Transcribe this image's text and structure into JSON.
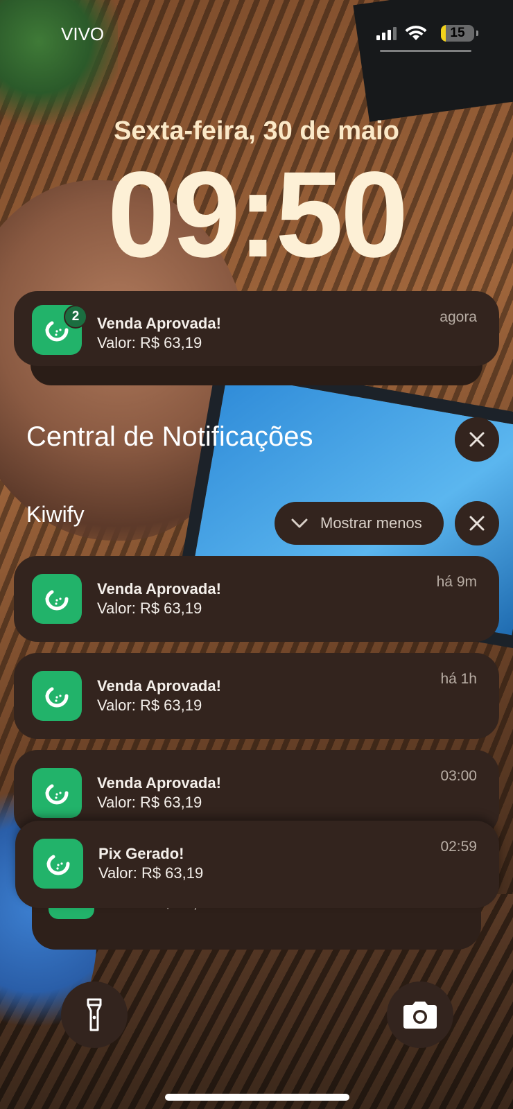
{
  "status_bar": {
    "carrier": "VIVO",
    "battery_level": "15",
    "battery_color": "#f2d21b",
    "icons": [
      "cellular-signal-icon",
      "wifi-icon",
      "battery-icon"
    ]
  },
  "lock_screen": {
    "date": "Sexta-feira, 30 de maio",
    "time": "09:50"
  },
  "top_notification": {
    "app": "Kiwify",
    "badge_count": "2",
    "title": "Venda Aprovada!",
    "body": "Valor: R$ 63,19",
    "time": "agora"
  },
  "notification_center": {
    "title": "Central de Notificações",
    "group_name": "Kiwify",
    "show_less_label": "Mostrar menos",
    "notifications": [
      {
        "title": "Venda Aprovada!",
        "body": "Valor: R$ 63,19",
        "time": "há 9m"
      },
      {
        "title": "Venda Aprovada!",
        "body": "Valor: R$ 63,19",
        "time": "há 1h"
      },
      {
        "title": "Venda Aprovada!",
        "body": "Valor: R$ 63,19",
        "time": "03:00"
      },
      {
        "title": "Pix Gerado!",
        "body": "Valor: R$ 63,19",
        "time": "02:59"
      },
      {
        "title": "",
        "body": "Valor: R$ 63,19",
        "time": ""
      }
    ]
  },
  "bottom_controls": {
    "left_icon": "flashlight-icon",
    "right_icon": "camera-icon"
  },
  "colors": {
    "app_icon": "#22b36a",
    "card_background": "#33241e"
  }
}
